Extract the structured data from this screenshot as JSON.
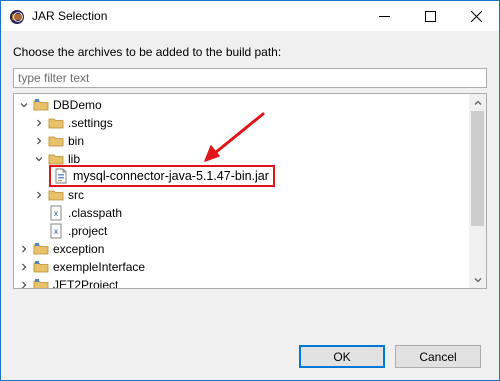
{
  "window": {
    "title": "JAR Selection"
  },
  "prompt": "Choose the archives to be added to the build path:",
  "filter": {
    "placeholder": "type filter text",
    "value": ""
  },
  "tree": [
    {
      "label": "DBDemo",
      "icon": "project-folder-icon",
      "state": "expanded"
    },
    {
      "label": ".settings",
      "icon": "folder-icon",
      "state": "collapsed"
    },
    {
      "label": "bin",
      "icon": "folder-icon",
      "state": "collapsed"
    },
    {
      "label": "lib",
      "icon": "folder-icon",
      "state": "expanded"
    },
    {
      "label": "mysql-connector-java-5.1.47-bin.jar",
      "icon": "jar-file-icon",
      "state": "leaf",
      "highlighted": true
    },
    {
      "label": "src",
      "icon": "folder-icon",
      "state": "collapsed"
    },
    {
      "label": ".classpath",
      "icon": "xml-file-icon",
      "state": "leaf"
    },
    {
      "label": ".project",
      "icon": "xml-file-icon",
      "state": "leaf"
    },
    {
      "label": "exception",
      "icon": "project-folder-icon",
      "state": "collapsed"
    },
    {
      "label": "exempleInterface",
      "icon": "project-folder-icon",
      "state": "collapsed"
    },
    {
      "label": "JET2Project",
      "icon": "project-folder-icon",
      "state": "collapsed"
    }
  ],
  "buttons": {
    "ok": "OK",
    "cancel": "Cancel"
  },
  "colors": {
    "highlight_border": "#e0161b",
    "annotation_arrow": "#e0161b",
    "default_button_border": "#0078d7"
  }
}
